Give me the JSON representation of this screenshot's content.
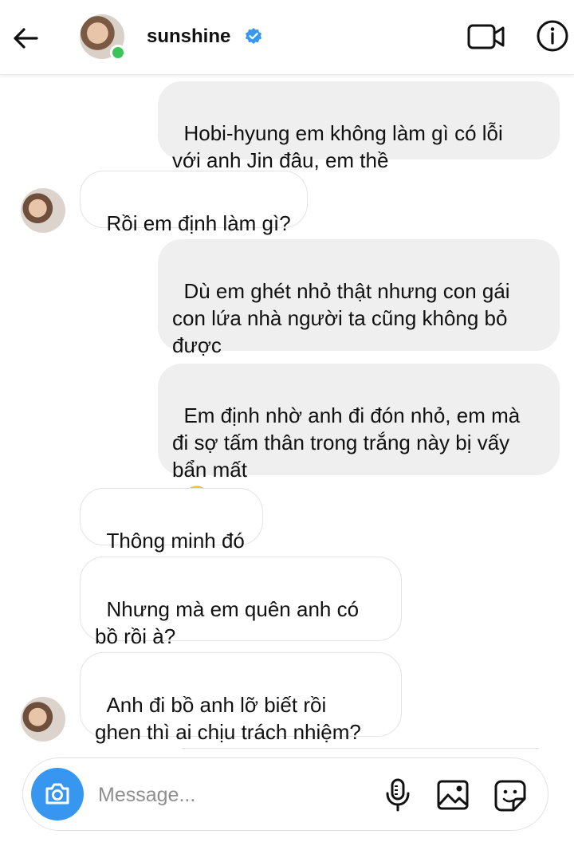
{
  "header": {
    "username": "sunshine",
    "icons": [
      "back-arrow-icon",
      "verified-badge-icon",
      "video-call-icon",
      "info-icon"
    ],
    "online_color": "#3bc45a",
    "verified_color": "#3897f0"
  },
  "messages": [
    {
      "sender": "me",
      "text": "Hobi-hyung em không làm gì có lỗi\nvới anh Jin đâu, em thề",
      "emoji": "✋"
    },
    {
      "sender": "them",
      "text": "Rồi em định làm gì?"
    },
    {
      "sender": "me",
      "text": "Dù em ghét nhỏ thật nhưng con gái\ncon lứa nhà người ta cũng không bỏ\nđược"
    },
    {
      "sender": "me",
      "text": "Em định nhờ anh đi đón nhỏ, em mà\nđi sợ tấm thân trong trắng này bị vấy\nbẩn mất",
      "emoji": "😭"
    },
    {
      "sender": "them",
      "text": "Thông minh đó"
    },
    {
      "sender": "them",
      "text": "Nhưng mà em quên anh có\nbồ rồi à?"
    },
    {
      "sender": "them",
      "text": "Anh đi bồ anh lỡ biết rồi\nghen thì ai chịu trách nhiệm?"
    }
  ],
  "composer": {
    "placeholder": "Message...",
    "icons": [
      "camera-icon",
      "microphone-icon",
      "gallery-icon",
      "sticker-icon"
    ],
    "camera_color": "#3797f0"
  }
}
